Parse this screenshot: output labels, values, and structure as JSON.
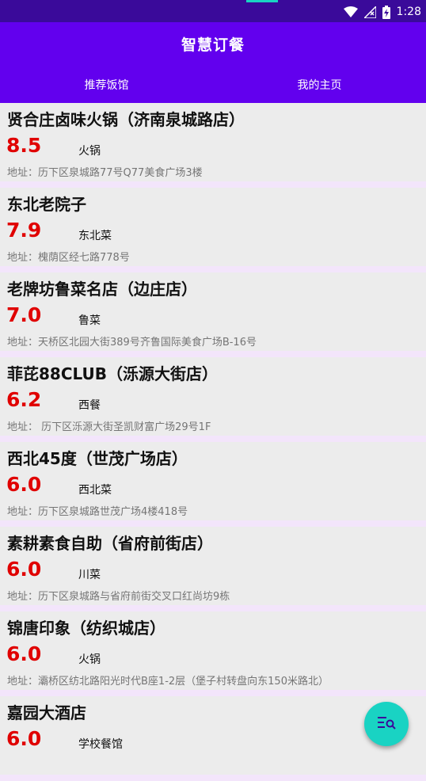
{
  "status_bar": {
    "time": "1:28",
    "icons": [
      "wifi-icon",
      "signal-icon",
      "battery-charging-icon"
    ]
  },
  "app": {
    "title": "智慧订餐",
    "tabs": [
      {
        "label": "推荐饭馆"
      },
      {
        "label": "我的主页"
      }
    ]
  },
  "restaurants": [
    {
      "name": "贤合庄卤味火锅（济南泉城路店）",
      "score": "8.5",
      "type": "火锅",
      "address": "地址：历下区泉城路77号Q77美食广场3楼"
    },
    {
      "name": "东北老院子",
      "score": "7.9",
      "type": "东北菜",
      "address": "地址：槐荫区经七路778号"
    },
    {
      "name": "老牌坊鲁菜名店（边庄店）",
      "score": "7.0",
      "type": "鲁菜",
      "address": "地址：天桥区北园大街389号齐鲁国际美食广场B-16号"
    },
    {
      "name": "菲芘88CLUB（泺源大街店）",
      "score": "6.2",
      "type": "西餐",
      "address": "地址： 历下区泺源大街圣凯财富广场29号1F"
    },
    {
      "name": "西北45度（世茂广场店）",
      "score": "6.0",
      "type": "西北菜",
      "address": "地址：历下区泉城路世茂广场4楼418号"
    },
    {
      "name": "素耕素食自助（省府前街店）",
      "score": "6.0",
      "type": "川菜",
      "address": "地址：历下区泉城路与省府前街交叉口红尚坊9栋"
    },
    {
      "name": "锦唐印象（纺织城店）",
      "score": "6.0",
      "type": "火锅",
      "address": "地址：灞桥区纺北路阳光时代B座1-2层（堡子村转盘向东150米路北）"
    },
    {
      "name": "嘉园大酒店",
      "score": "6.0",
      "type": "学校餐馆",
      "address": ""
    }
  ],
  "fab": {
    "icon": "search-list-icon"
  },
  "colors": {
    "status_bar": "#3a0a9a",
    "app_bar": "#6200ee",
    "score": "#e00000",
    "fab": "#19d3c3",
    "divider": "#f3e5fb"
  }
}
